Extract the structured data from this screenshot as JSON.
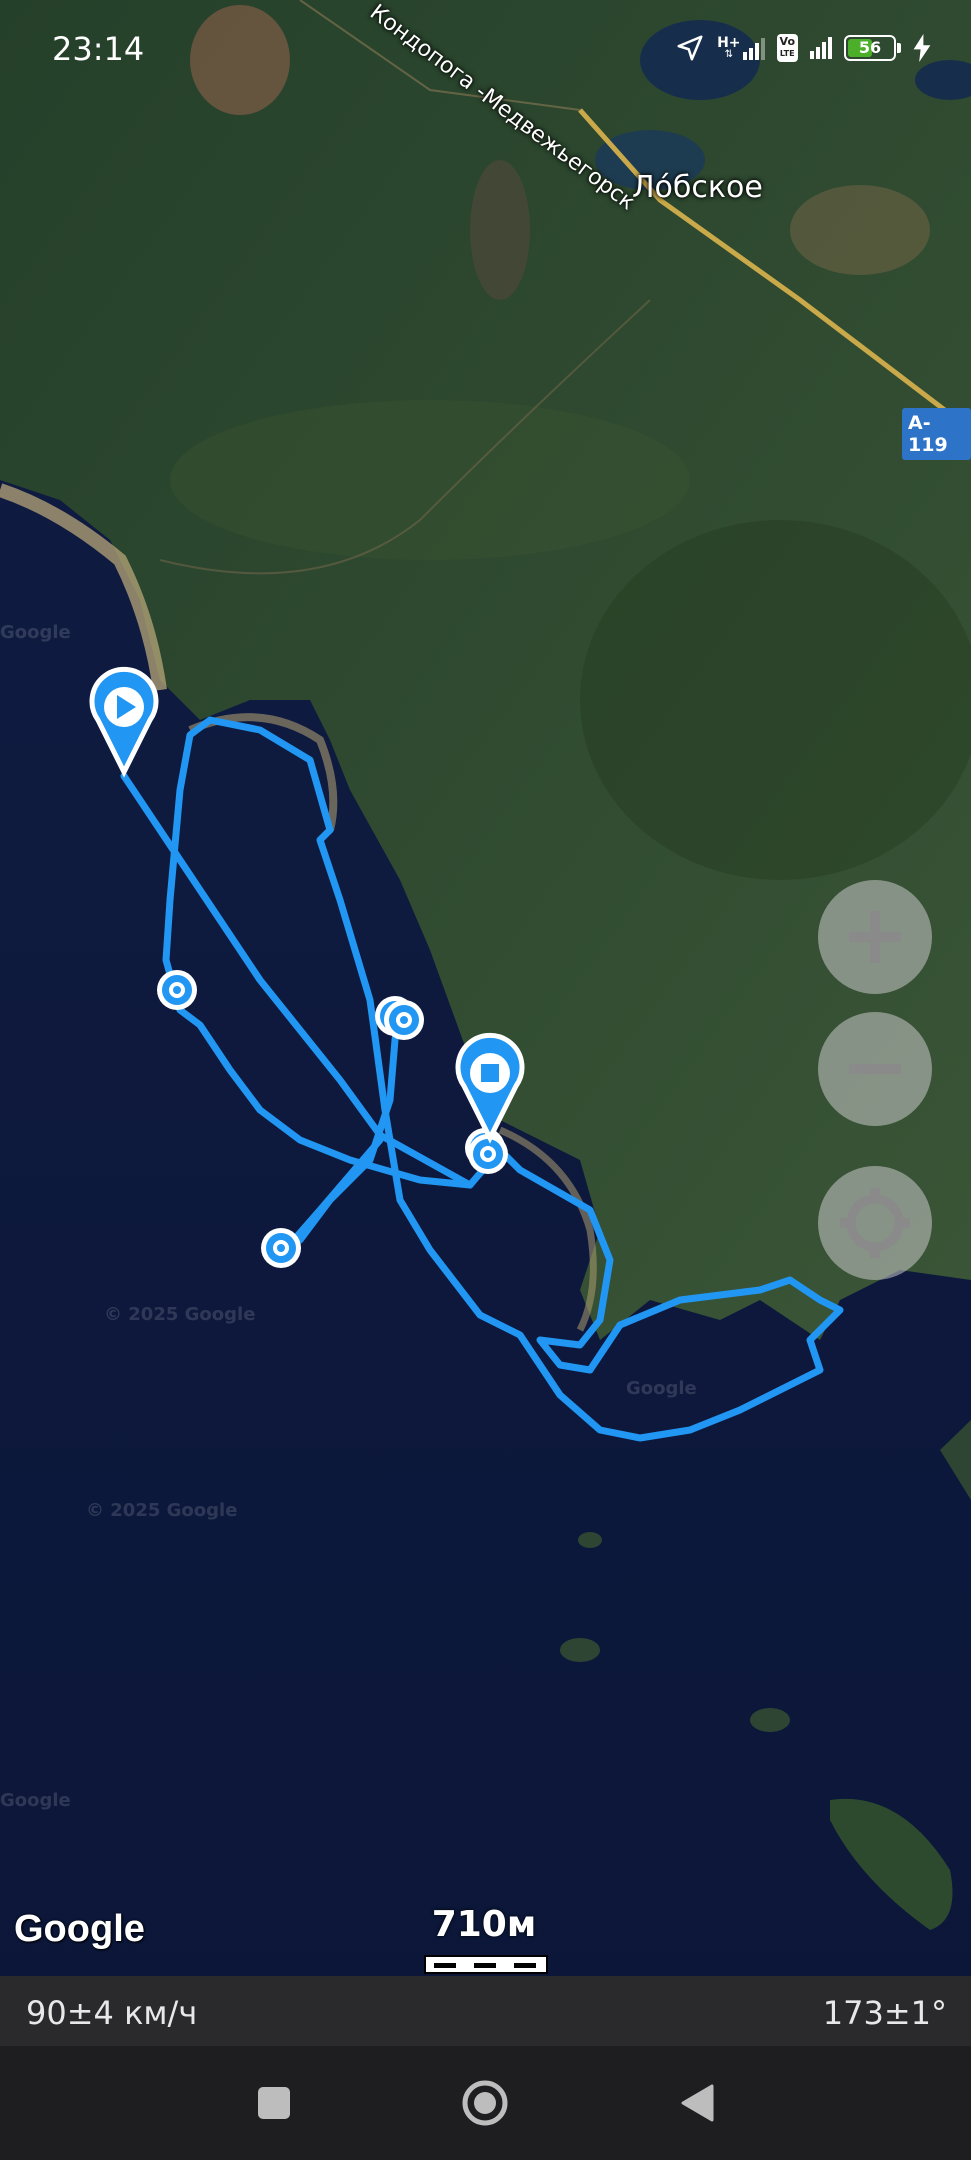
{
  "status_bar": {
    "time": "23:14",
    "network_label": "H+",
    "volte_top": "Vo",
    "volte_bottom": "LTE",
    "battery_level": "56",
    "icons": [
      "location-arrow-icon",
      "signal-icon",
      "volte-icon",
      "signal-icon",
      "battery-icon",
      "charging-bolt-icon"
    ]
  },
  "map": {
    "place_label": "Лóбское",
    "road_label": "Кондопога -Медвежьегорск",
    "road_badge": "A-119",
    "watermarks": [
      "Google",
      "© 2025 Google",
      "© 2025 Google",
      "Google",
      "Google"
    ],
    "google_logo": "Google",
    "scale_label": "710м",
    "route_color": "#2196f3",
    "start_marker": "play-icon",
    "end_marker": "stop-icon"
  },
  "controls": {
    "zoom_in": "plus-icon",
    "zoom_out": "minus-icon",
    "my_location": "target-icon"
  },
  "info_bar": {
    "speed": "90±4 км/ч",
    "heading": "173±1°"
  },
  "nav_bar": {
    "buttons": [
      "recents-square-icon",
      "home-circle-icon",
      "back-triangle-icon"
    ]
  }
}
